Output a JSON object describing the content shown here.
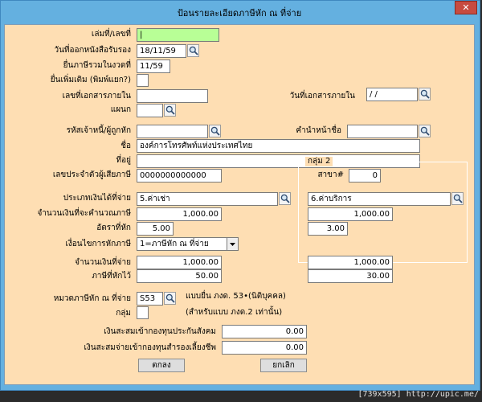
{
  "window": {
    "title": "ป้อนรายละเอียดภาษีหัก ณ ที่จ่าย",
    "close_glyph": "✕"
  },
  "form": {
    "doc_no": {
      "label": "เล่มที่/เลขที่",
      "value": "|"
    },
    "cert_date": {
      "label": "วันที่ออกหนังสือรับรอง",
      "value": "18/11/59"
    },
    "tax_month": {
      "label": "ยื่นภาษีรวมในงวดที่",
      "value": "11/59"
    },
    "additional": {
      "label": "ยื่นเพิ่มเติม (พิมพ์แยก?)"
    },
    "internal_doc": {
      "label": "เลขที่เอกสารภายใน",
      "value": ""
    },
    "internal_date": {
      "label": "วันที่เอกสารภายใน",
      "value": " / /"
    },
    "department": {
      "label": "แผนก",
      "value": ""
    },
    "payee_code": {
      "label": "รหัสเจ้าหนี้/ผู้ถูกหัก",
      "value": ""
    },
    "prefix": {
      "label": "คำนำหน้าชื่อ",
      "value": ""
    },
    "name": {
      "label": "ชื่อ",
      "value": "องค์การโทรศัพท์แห่งประเทศไทย"
    },
    "address": {
      "label": "ที่อยู่",
      "value": ""
    },
    "taxpayer_id": {
      "label": "เลขประจำตัวผู้เสียภาษี",
      "value": "0000000000000"
    },
    "branch": {
      "label": "สาขา#",
      "value": "0"
    },
    "income_type": {
      "label": "ประเภทเงินได้ที่จ่าย",
      "value": "5.ค่าเช่า"
    },
    "taxable_amount": {
      "label": "จำนวนเงินที่จะคำนวณภาษี",
      "value": "1,000.00"
    },
    "tax_rate": {
      "label": "อัตราที่หัก",
      "value": "5.00"
    },
    "condition": {
      "label": "เงื่อนไขการหักภาษี",
      "value": "1=ภาษีหัก ณ ที่จ่าย"
    },
    "paid_amount": {
      "label": "จำนวนเงินที่จ่าย",
      "value": "1,000.00"
    },
    "tax_withheld": {
      "label": "ภาษีที่หักไว้",
      "value": "50.00"
    },
    "category": {
      "label": "หมวดภาษีหัก ณ ที่จ่าย",
      "value": "S53",
      "note": "แบบยื่น ภงด. 53•(นิติบุคคล)"
    },
    "group": {
      "label": "กลุ่ม",
      "note": "(สำหรับแบบ ภงด.2 เท่านั้น)"
    },
    "social_security": {
      "label": "เงินสะสมเข้ากองทุนประกันสังคม",
      "value": "0.00"
    },
    "provident_fund": {
      "label": "เงินสะสมจ่ายเข้ากองทุนสำรองเลี้ยงชีพ",
      "value": "0.00"
    }
  },
  "group2": {
    "label": "กลุ่ม 2",
    "income_type": "6.ค่าบริการ",
    "taxable_amount": "1,000.00",
    "tax_rate": "3.00",
    "paid_amount": "1,000.00",
    "tax_withheld": "30.00"
  },
  "buttons": {
    "ok": "ตกลง",
    "cancel": "ยกเลิก"
  },
  "watermark": "[739x595] http://upic.me/",
  "colors": {
    "background": "#fedeb3",
    "title_bar": "#64b0e0",
    "focused_input": "#b8ff96",
    "close_button": "#c74b40"
  }
}
